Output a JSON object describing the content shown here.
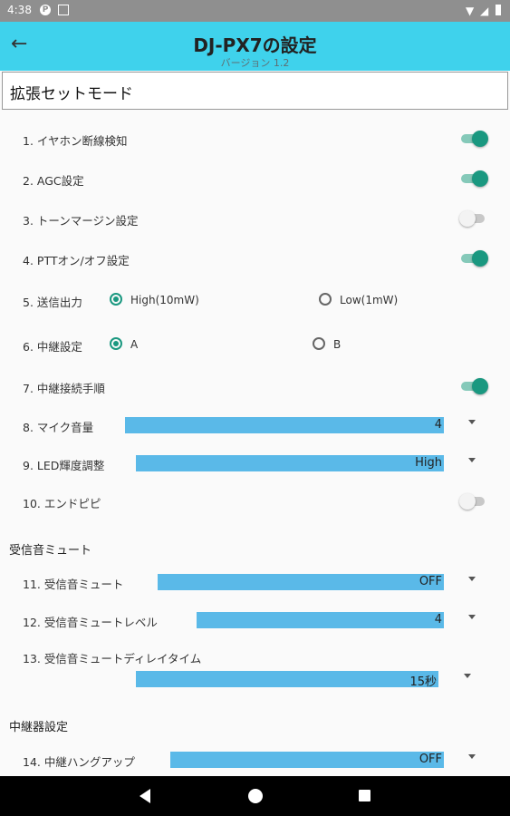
{
  "status_bar": {
    "time": "4:38",
    "app_icon": "P",
    "signal_icon": "wifi-icon",
    "battery_icon": "battery-icon"
  },
  "app_bar": {
    "title": "DJ-PX7の設定",
    "subtitle": "バージョン 1.2",
    "back_icon": "back-arrow-icon"
  },
  "mode_header": "拡張セットモード",
  "settings": {
    "s1": {
      "label": "1. イヤホン断線検知",
      "state": "on"
    },
    "s2": {
      "label": "2. AGC設定",
      "state": "on"
    },
    "s3": {
      "label": "3. トーンマージン設定",
      "state": "off"
    },
    "s4": {
      "label": "4. PTTオン/オフ設定",
      "state": "on"
    },
    "s5": {
      "label": "5. 送信出力",
      "options": [
        "High(10mW)",
        "Low(1mW)"
      ],
      "selected": "High(10mW)"
    },
    "s6": {
      "label": "6. 中継設定",
      "options": [
        "A",
        "B"
      ],
      "selected": "A"
    },
    "s7": {
      "label": "7. 中継接続手順",
      "state": "on"
    },
    "s8": {
      "label": "8. マイク音量",
      "value": "4"
    },
    "s9": {
      "label": "9. LED輝度調整",
      "value": "High"
    },
    "s10": {
      "label": "10. エンドピピ",
      "state": "off"
    }
  },
  "section_mute": {
    "title": "受信音ミュート",
    "s11": {
      "label": "11. 受信音ミュート",
      "value": "OFF"
    },
    "s12": {
      "label": "12. 受信音ミュートレベル",
      "value": "4"
    },
    "s13": {
      "label": "13. 受信音ミュートディレイタイム",
      "value": "15秒"
    }
  },
  "section_repeater": {
    "title": "中継器設定",
    "s14": {
      "label": "14. 中継ハングアップ",
      "value": "OFF"
    }
  },
  "nav_bar": {
    "back": "nav-back-icon",
    "home": "nav-home-icon",
    "recent": "nav-recent-icon"
  },
  "colors": {
    "appbar": "#3fd2ec",
    "accent": "#1a9880",
    "select_fill": "#5ab9e8",
    "navbar": "#000000"
  }
}
